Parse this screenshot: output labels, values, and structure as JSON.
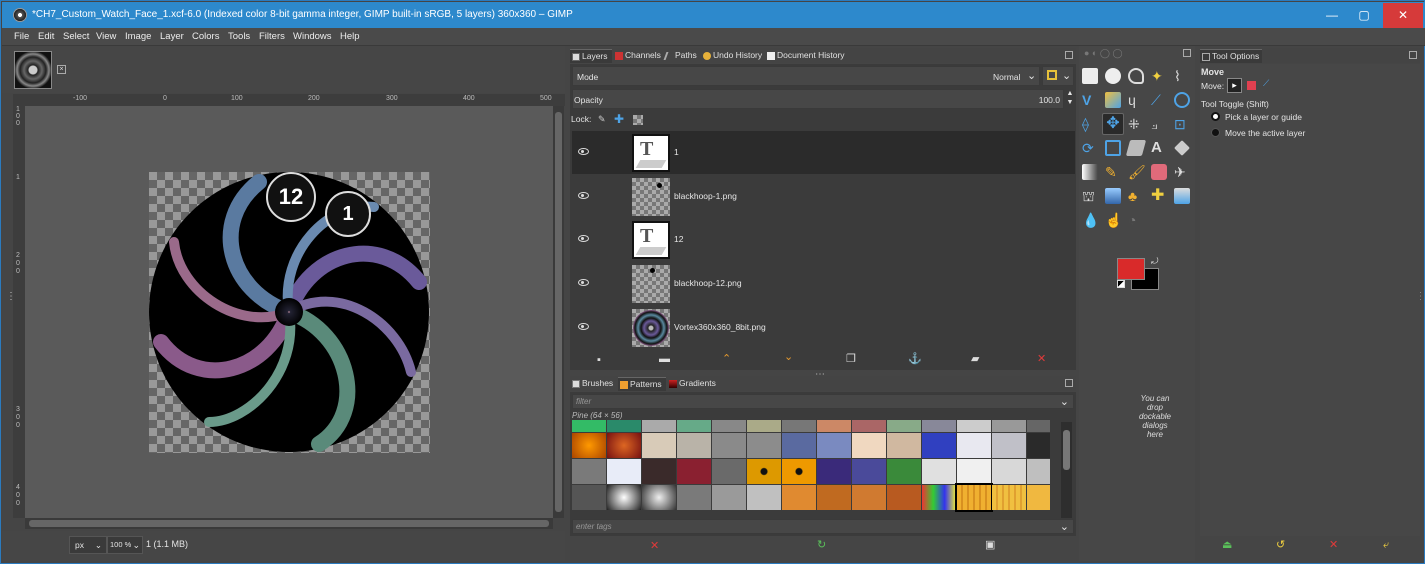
{
  "window": {
    "title": "*CH7_Custom_Watch_Face_1.xcf-6.0 (Indexed color 8-bit gamma integer, GIMP built-in sRGB, 5 layers) 360x360 – GIMP",
    "minimize": "—",
    "maximize": "▢",
    "close": "✕"
  },
  "menu": [
    "File",
    "Edit",
    "Select",
    "View",
    "Image",
    "Layer",
    "Colors",
    "Tools",
    "Filters",
    "Windows",
    "Help"
  ],
  "canvas": {
    "ruler_h": [
      "-100",
      "0",
      "100",
      "200",
      "300",
      "400",
      "500"
    ],
    "ruler_v": [
      "1",
      "0",
      "0",
      "1",
      "0",
      "0",
      "2",
      "0",
      "0",
      "3",
      "0",
      "0",
      "4",
      "0",
      "0"
    ],
    "badge_12": "12",
    "badge_1": "1"
  },
  "statusbar": {
    "unit": "px",
    "zoom": "100 %",
    "info": "1 (1.1 MB)"
  },
  "layers_dock": {
    "tabs": [
      "Layers",
      "Channels",
      "Paths",
      "Undo History",
      "Document History"
    ],
    "mode_label": "Mode",
    "mode_value": "Normal",
    "opacity_label": "Opacity",
    "opacity_value": "100.0",
    "lock_label": "Lock:",
    "layers": [
      {
        "name": "1",
        "type": "text"
      },
      {
        "name": "blackhoop-1.png",
        "type": "image"
      },
      {
        "name": "12",
        "type": "text"
      },
      {
        "name": "blackhoop-12.png",
        "type": "image"
      },
      {
        "name": "Vortex360x360_8bit.png",
        "type": "image"
      }
    ]
  },
  "patterns_dock": {
    "tabs": [
      "Brushes",
      "Patterns",
      "Gradients"
    ],
    "filter_placeholder": "filter",
    "selected": "Pine (64 × 56)",
    "tags_placeholder": "enter tags"
  },
  "toolbox": {
    "drop_hint": "You can drop dockable dialogs here",
    "fg_color": "#d92a2a",
    "bg_color": "#000000"
  },
  "tool_options": {
    "tab": "Tool Options",
    "title": "Move",
    "move_label": "Move:",
    "toggle_label": "Tool Toggle  (Shift)",
    "option1": "Pick a layer or guide",
    "option2": "Move the active layer"
  }
}
